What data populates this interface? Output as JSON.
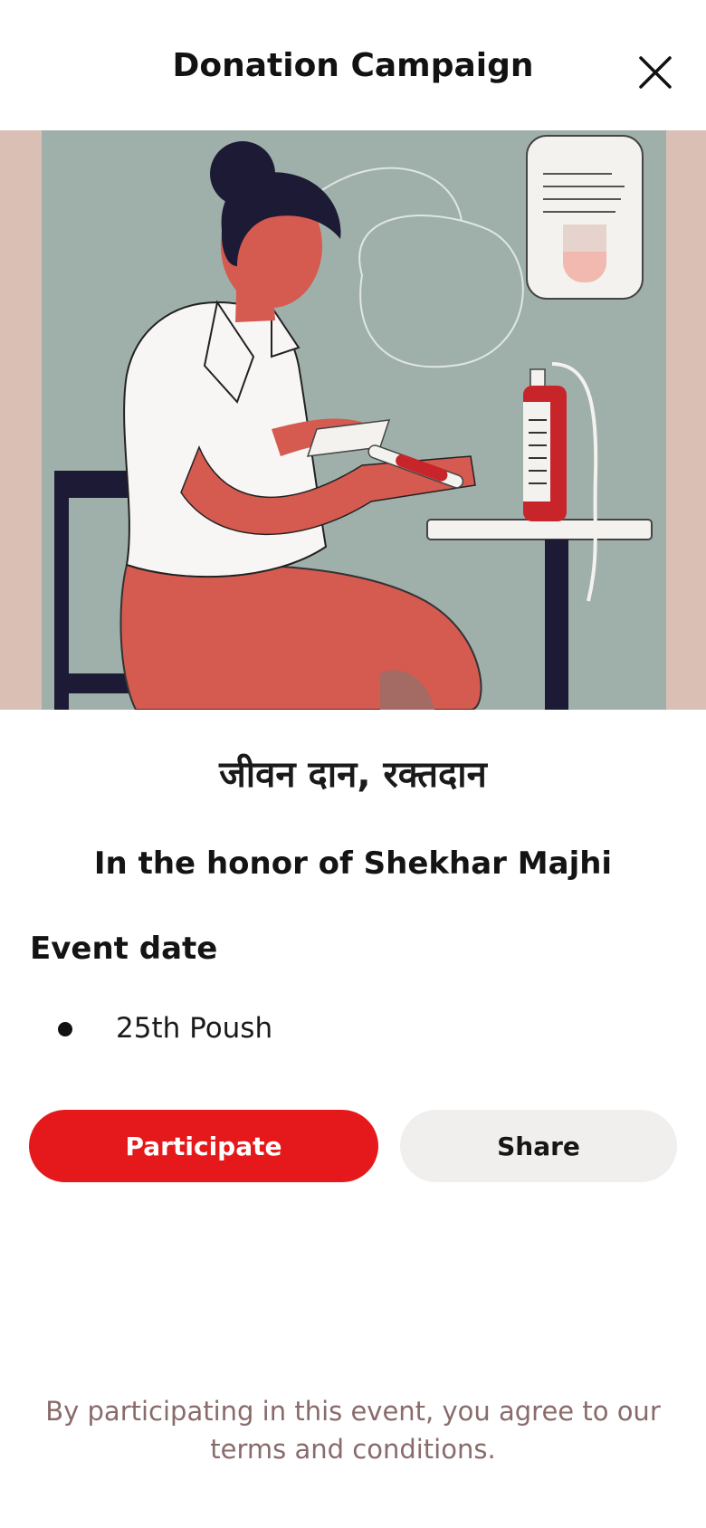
{
  "header": {
    "title": "Donation Campaign",
    "close_icon": "close-icon"
  },
  "hero": {
    "icon": "blood-donation-illustration"
  },
  "campaign": {
    "name": "जीवन दान, रक्तदान",
    "honor_text": "In the honor of Shekhar Majhi",
    "event_date_label": "Event date",
    "event_dates": [
      "25th Poush"
    ]
  },
  "actions": {
    "participate_label": "Participate",
    "share_label": "Share"
  },
  "footer": {
    "terms_text": "By participating in this event, you agree to our terms and conditions."
  },
  "colors": {
    "accent": "#e5191b",
    "secondary_button": "#f1efee",
    "terms_text": "#8a6b6b"
  }
}
